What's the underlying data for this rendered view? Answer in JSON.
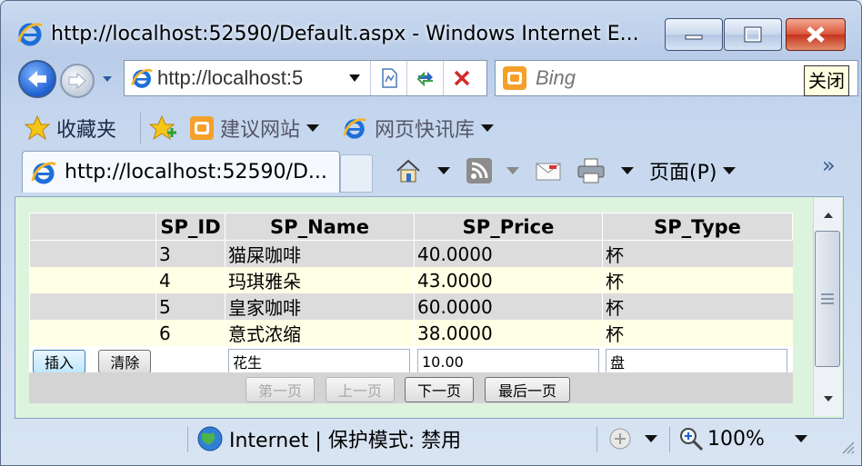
{
  "window": {
    "title": "http://localhost:52590/Default.aspx - Windows Internet E...",
    "close_tooltip": "关闭"
  },
  "address_bar": {
    "url": "http://localhost:5"
  },
  "search_box": {
    "placeholder": "Bing"
  },
  "favorites_bar": {
    "favorites_label": "收藏夹",
    "items": [
      "建议网站",
      "网页快讯库"
    ]
  },
  "tabs": [
    {
      "label": "http://localhost:52590/D..."
    }
  ],
  "command_bar": {
    "page_menu": "页面(P)"
  },
  "grid": {
    "columns": [
      "SP_ID",
      "SP_Name",
      "SP_Price",
      "SP_Type"
    ],
    "rows": [
      {
        "id": "3",
        "name": "猫屎咖啡",
        "price": "40.0000",
        "type": "杯"
      },
      {
        "id": "4",
        "name": "玛琪雅朵",
        "price": "43.0000",
        "type": "杯"
      },
      {
        "id": "5",
        "name": "皇家咖啡",
        "price": "60.0000",
        "type": "杯"
      },
      {
        "id": "6",
        "name": "意式浓缩",
        "price": "38.0000",
        "type": "杯"
      }
    ],
    "insert_row": {
      "insert_label": "插入",
      "clear_label": "清除",
      "name_value": "花生",
      "price_value": "10.00",
      "type_value": "盘"
    },
    "pager": {
      "first": "第一页",
      "prev": "上一页",
      "next": "下一页",
      "last": "最后一页"
    }
  },
  "status_bar": {
    "zone_text": "Internet | 保护模式: 禁用",
    "zoom": "100%"
  },
  "colors": {
    "content_background": "#dcf3de",
    "row_odd": "#dcdcdc",
    "row_even": "#ffffe5",
    "close_button": "#d9553a"
  }
}
